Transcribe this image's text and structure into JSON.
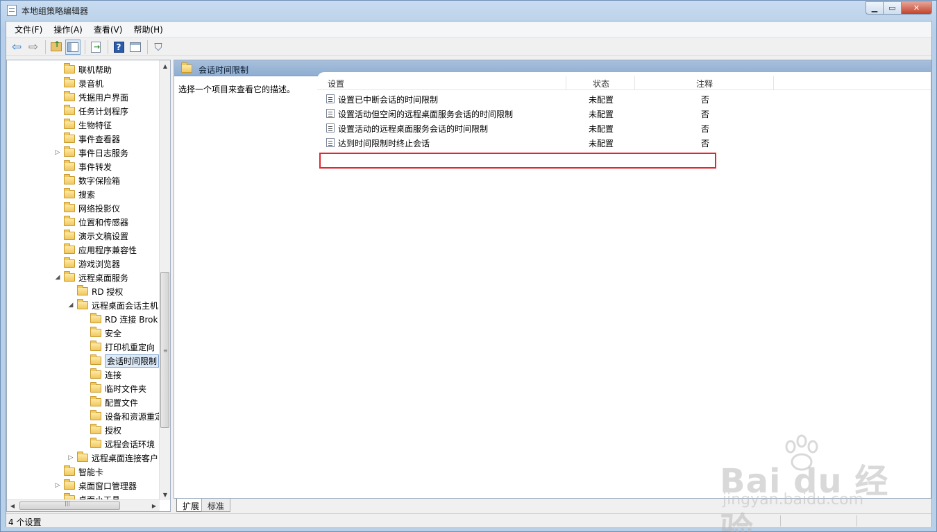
{
  "window": {
    "title": "本地组策略编辑器"
  },
  "menu": [
    "文件(F)",
    "操作(A)",
    "查看(V)",
    "帮助(H)"
  ],
  "toolbar": [
    "back-arrow-icon",
    "forward-arrow-icon",
    "folder-up-icon",
    "show-hide-tree-icon",
    "export-list-icon",
    "help-icon",
    "properties-icon",
    "filter-icon"
  ],
  "tree": {
    "items": [
      {
        "label": "联机帮助",
        "level": 1,
        "expander": ""
      },
      {
        "label": "录音机",
        "level": 1,
        "expander": ""
      },
      {
        "label": "凭据用户界面",
        "level": 1,
        "expander": ""
      },
      {
        "label": "任务计划程序",
        "level": 1,
        "expander": ""
      },
      {
        "label": "生物特征",
        "level": 1,
        "expander": ""
      },
      {
        "label": "事件查看器",
        "level": 1,
        "expander": ""
      },
      {
        "label": "事件日志服务",
        "level": 1,
        "expander": "▷"
      },
      {
        "label": "事件转发",
        "level": 1,
        "expander": ""
      },
      {
        "label": "数字保险箱",
        "level": 1,
        "expander": ""
      },
      {
        "label": "搜索",
        "level": 1,
        "expander": ""
      },
      {
        "label": "网络投影仪",
        "level": 1,
        "expander": ""
      },
      {
        "label": "位置和传感器",
        "level": 1,
        "expander": ""
      },
      {
        "label": "演示文稿设置",
        "level": 1,
        "expander": ""
      },
      {
        "label": "应用程序兼容性",
        "level": 1,
        "expander": ""
      },
      {
        "label": "游戏浏览器",
        "level": 1,
        "expander": ""
      },
      {
        "label": "远程桌面服务",
        "level": 1,
        "expander": "◢"
      },
      {
        "label": "RD 授权",
        "level": 2,
        "expander": ""
      },
      {
        "label": "远程桌面会话主机",
        "level": 2,
        "expander": "◢"
      },
      {
        "label": "RD 连接 Brok",
        "level": 3,
        "expander": ""
      },
      {
        "label": "安全",
        "level": 3,
        "expander": ""
      },
      {
        "label": "打印机重定向",
        "level": 3,
        "expander": ""
      },
      {
        "label": "会话时间限制",
        "level": 3,
        "expander": "",
        "selected": true
      },
      {
        "label": "连接",
        "level": 3,
        "expander": ""
      },
      {
        "label": "临时文件夹",
        "level": 3,
        "expander": ""
      },
      {
        "label": "配置文件",
        "level": 3,
        "expander": ""
      },
      {
        "label": "设备和资源重定",
        "level": 3,
        "expander": ""
      },
      {
        "label": "授权",
        "level": 3,
        "expander": ""
      },
      {
        "label": "远程会话环境",
        "level": 3,
        "expander": ""
      },
      {
        "label": "远程桌面连接客户",
        "level": 2,
        "expander": "▷"
      },
      {
        "label": "智能卡",
        "level": 1,
        "expander": ""
      },
      {
        "label": "桌面窗口管理器",
        "level": 1,
        "expander": "▷"
      },
      {
        "label": "桌面小工具",
        "level": 1,
        "expander": ""
      }
    ]
  },
  "right": {
    "header_title": "会话时间限制",
    "description": "选择一个项目来查看它的描述。",
    "columns": {
      "setting": "设置",
      "state": "状态",
      "note": "注释"
    },
    "rows": [
      {
        "name": "设置已中断会话的时间限制",
        "state": "未配置",
        "note": "否"
      },
      {
        "name": "设置活动但空闲的远程桌面服务会话的时间限制",
        "state": "未配置",
        "note": "否"
      },
      {
        "name": "设置活动的远程桌面服务会话的时间限制",
        "state": "未配置",
        "note": "否"
      },
      {
        "name": "达到时间限制时终止会话",
        "state": "未配置",
        "note": "否"
      }
    ]
  },
  "tabs": {
    "extended": "扩展",
    "standard": "标准"
  },
  "status": {
    "text": "4 个设置"
  },
  "watermark": {
    "logo": "Bai du 经验",
    "url": "jingyan.baidu.com"
  },
  "colors": {
    "highlight": "#e0262e",
    "header_band": "#8faed1",
    "selection": "#dceaf8"
  }
}
